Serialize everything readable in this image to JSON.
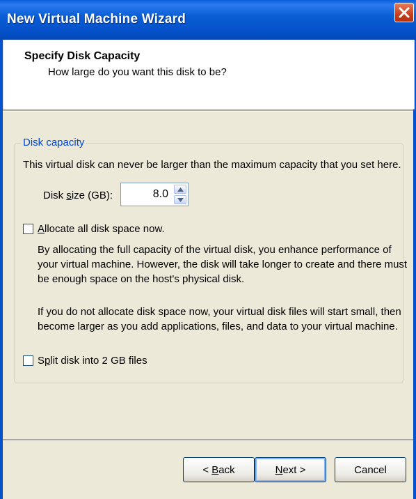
{
  "window": {
    "title": "New Virtual Machine Wizard"
  },
  "header": {
    "title": "Specify Disk Capacity",
    "subtitle": "How large do you want this disk to be?"
  },
  "group": {
    "label": "Disk capacity",
    "description": "This virtual disk can never be larger than the maximum capacity that you set here.",
    "disk_size_label_pre": "Disk ",
    "disk_size_label_u": "s",
    "disk_size_label_post": "ize (GB):",
    "disk_size_value": "8.0",
    "allocate_u": "A",
    "allocate_rest": "llocate all disk space now.",
    "allocate_desc_1": "By allocating the full capacity of the virtual disk, you enhance performance of",
    "allocate_desc_2": "your virtual machine.  However, the disk will take longer to create and there must",
    "allocate_desc_3": "be enough space on the host's physical disk.",
    "noalloc_desc_1": "If you do not allocate disk space now, your virtual disk files will start small, then",
    "noalloc_desc_2": "become larger as you add applications, files, and data to your virtual machine.",
    "split_pre": "S",
    "split_u": "p",
    "split_rest": "lit disk into 2 GB files",
    "allocate_checked": false,
    "split_checked": false
  },
  "buttons": {
    "back_pre": "< ",
    "back_u": "B",
    "back_rest": "ack",
    "next_u": "N",
    "next_rest": "ext >",
    "cancel": "Cancel"
  }
}
